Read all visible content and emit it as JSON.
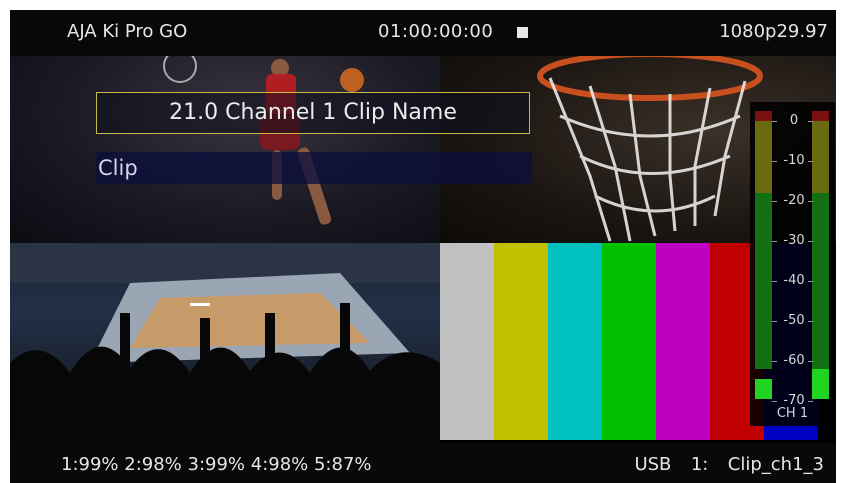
{
  "top_bar": {
    "title": "AJA Ki Pro GO",
    "timecode": "01:00:00:00",
    "transport_state_icon": "stop-icon",
    "video_format": "1080p29.97"
  },
  "overlay": {
    "clip_name_title": "21.0 Channel 1 Clip Name",
    "clip_label": "Clip"
  },
  "color_bars": [
    "#c0c0c0",
    "#c0c000",
    "#00c0c0",
    "#00c000",
    "#c000c0",
    "#c00000",
    "#0000c0"
  ],
  "audio_meter": {
    "scale": [
      "0",
      "-10",
      "-20",
      "-30",
      "-40",
      "-50",
      "-60",
      "-70"
    ],
    "channel_label": "CH 1",
    "level_colors": {
      "clip": "#7a1010",
      "warn": "#8a8a10",
      "normal": "#1a7a1a",
      "active": "#22d422"
    }
  },
  "bottom_bar": {
    "media_status": "1:99% 2:98% 3:99% 4:98% 5:87%",
    "recording_target": "USB  1:  Clip_ch1_3"
  }
}
